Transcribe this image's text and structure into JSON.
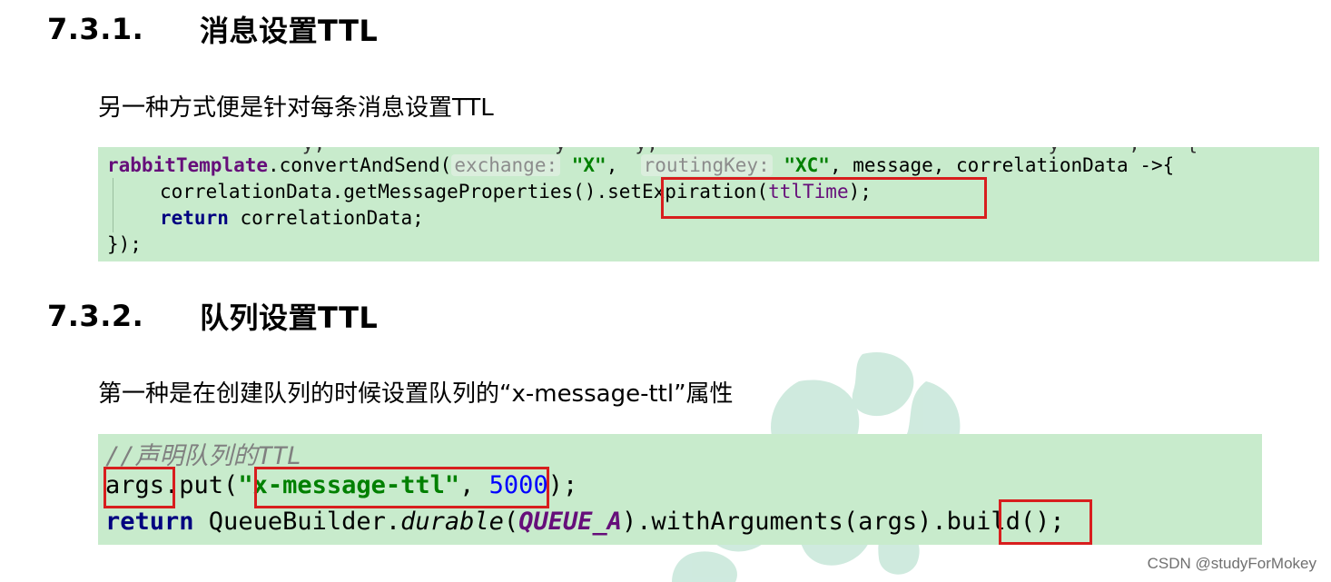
{
  "section_1": {
    "number": "7.3.1.",
    "title": "消息设置TTL",
    "paragraph": "另一种方式便是针对每条消息设置TTL",
    "code": {
      "top_cut_line": "                 y,                    y      y,                                  y      ,    {",
      "receiver": "rabbitTemplate",
      "method": ".convertAndSend(",
      "hint_exchange": "exchange:",
      "arg_exchange": "\"X\"",
      "hint_routing": "routingKey:",
      "arg_routing": "\"XC\"",
      "rest_line_1": ", message, correlationData ->{",
      "line_2_prefix": "correlationData.getMessageProperties()",
      "line_2_call": ".setExpiration(",
      "line_2_param": "ttlTime",
      "line_2_end": ");",
      "kw_return": "return",
      "line_3_rest": " correlationData;",
      "line_4": "});",
      "bottom_cut_line": "                    -     -     -      -      -     -"
    }
  },
  "section_2": {
    "number": "7.3.2.",
    "title": "队列设置TTL",
    "paragraph": "第一种是在创建队列的时候设置队列的“x-message-ttl”属性",
    "code": {
      "comment": "//声明队列的TTL",
      "args": "args",
      "put": ".put(",
      "key": "\"x-message-ttl\"",
      "comma": ", ",
      "value": "5000",
      "put_end": ");",
      "kw_return": "return",
      "builder": " QueueBuilder.",
      "durable": "durable",
      "paren_open": "(",
      "queue_const": "QUEUE_A",
      "with_args": ").withArguments",
      "args_call": "(args)",
      "build": ".build();"
    }
  },
  "watermark": {
    "credit": "CSDN @studyForMokey",
    "art_color": "#bfe3d4"
  },
  "colors": {
    "code_bg": "#c8ebcc",
    "highlight_border": "#d81e1e"
  }
}
